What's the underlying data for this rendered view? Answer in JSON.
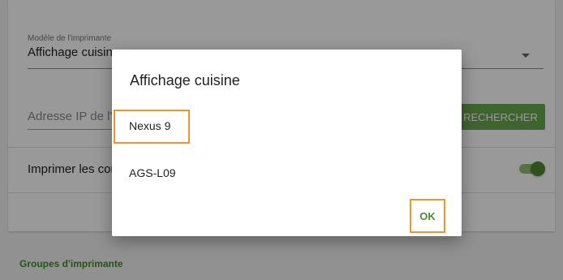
{
  "settings": {
    "printer_model_label": "Modèle de l'imprimante",
    "printer_model_value": "Affichage cuisine",
    "ip_placeholder": "Adresse IP de l'imprimante",
    "search_button_label": "RECHERCHER",
    "print_toggle_label": "Imprimer les commandes",
    "print_toggle_on": true,
    "printer_groups_section": "Groupes d'imprimante"
  },
  "dialog": {
    "title": "Affichage cuisine",
    "options": [
      "Nexus 9",
      "AGS-L09"
    ],
    "ok_label": "OK"
  },
  "colors": {
    "accent": "#6aa84f",
    "accent_dark": "#4c8a2e",
    "highlight": "#f0932b"
  }
}
